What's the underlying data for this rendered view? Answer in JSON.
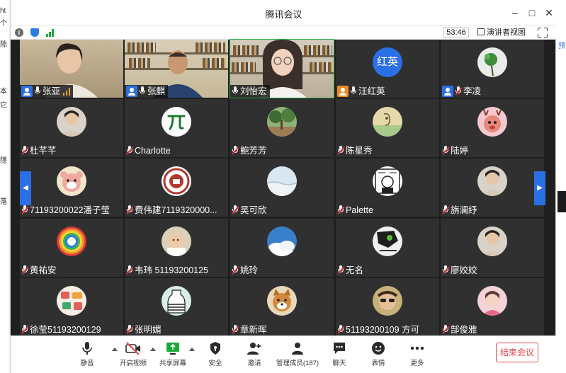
{
  "window": {
    "title": "腾讯会议"
  },
  "status": {
    "timer": "53:46",
    "speaker_view_label": "演讲者视图"
  },
  "colors": {
    "accent": "#2b6fe6",
    "active_speaker": "#27b24a",
    "end": "#e0474c",
    "tile_bg": "#303030"
  },
  "background_app": {
    "fragments": [
      "ht",
      "个",
      "隙",
      "本",
      "它",
      "隱",
      "落"
    ],
    "right_link": "预"
  },
  "participants": [
    {
      "name": "张亚",
      "role": "host",
      "mic": "on",
      "video": true,
      "speaking_level": "high"
    },
    {
      "name": "张麒",
      "role": "host",
      "mic": "on",
      "video": true
    },
    {
      "name": "刘怡宏",
      "role": "none",
      "mic": "on",
      "video": true,
      "active": true
    },
    {
      "name": "汪红英",
      "role": "cohost",
      "mic": "on",
      "video": false,
      "avatar_text": "红英"
    },
    {
      "name": "李凌",
      "role": "host",
      "mic": "muted",
      "video": false,
      "avatar": "green-plant"
    },
    {
      "name": "杜芊芊",
      "role": "none",
      "mic": "muted",
      "video": false,
      "avatar": "portrait"
    },
    {
      "name": "Charlotte",
      "role": "none",
      "mic": "muted",
      "video": false,
      "avatar": "pi-symbol"
    },
    {
      "name": "鲍芳芳",
      "role": "none",
      "mic": "muted",
      "video": false,
      "avatar": "forest"
    },
    {
      "name": "陈星秀",
      "role": "none",
      "mic": "muted",
      "video": false,
      "avatar": "sketch"
    },
    {
      "name": "陆婷",
      "role": "none",
      "mic": "muted",
      "video": false,
      "avatar": "cartoon-deer"
    },
    {
      "name": "71193200022潘子莹",
      "role": "none",
      "mic": "muted",
      "video": false,
      "avatar": "cartoon-bear"
    },
    {
      "name": "费伟建7119320000...",
      "role": "none",
      "mic": "muted",
      "video": false,
      "avatar": "school-seal"
    },
    {
      "name": "吴可欣",
      "role": "none",
      "mic": "muted",
      "video": false,
      "avatar": "sky"
    },
    {
      "name": "Palette",
      "role": "none",
      "mic": "muted",
      "video": false,
      "avatar": "comic"
    },
    {
      "name": "旃澜纾",
      "role": "none",
      "mic": "muted",
      "video": false,
      "avatar": "portrait"
    },
    {
      "name": "黄祐安",
      "role": "none",
      "mic": "muted",
      "video": false,
      "avatar": "rainbow"
    },
    {
      "name": "韦玮 51193200125",
      "role": "none",
      "mic": "muted",
      "video": false,
      "avatar": "baby"
    },
    {
      "name": "姚玲",
      "role": "none",
      "mic": "muted",
      "video": false,
      "avatar": "clouds"
    },
    {
      "name": "无名",
      "role": "none",
      "mic": "muted",
      "video": false,
      "avatar": "dark-art"
    },
    {
      "name": "廖姣姣",
      "role": "none",
      "mic": "muted",
      "video": false,
      "avatar": "portrait"
    },
    {
      "name": "徐莹51193200129",
      "role": "none",
      "mic": "muted",
      "video": false,
      "avatar": "stickers"
    },
    {
      "name": "张明媚",
      "role": "none",
      "mic": "muted",
      "video": false,
      "avatar": "bottle"
    },
    {
      "name": "章新晖",
      "role": "none",
      "mic": "muted",
      "video": false,
      "avatar": "dog"
    },
    {
      "name": "51193200109 方可",
      "role": "none",
      "mic": "muted",
      "video": false,
      "avatar": "sunglasses"
    },
    {
      "name": "郜俊雅",
      "role": "none",
      "mic": "muted",
      "video": false,
      "avatar": "pink-portrait"
    }
  ],
  "toolbar": {
    "mute": "静音",
    "video": "开启视频",
    "share": "共享屏幕",
    "security": "安全",
    "invite": "邀请",
    "members": "管理成员(187)",
    "chat": "聊天",
    "reactions": "表情",
    "more": "更多",
    "end": "结束会议"
  }
}
